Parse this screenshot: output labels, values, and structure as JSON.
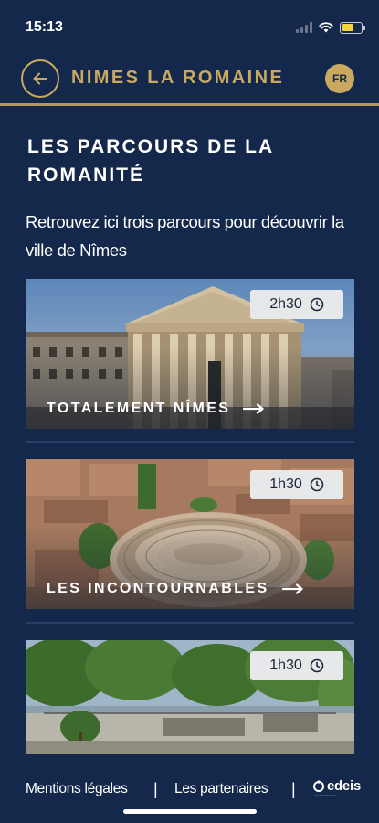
{
  "status_bar": {
    "time": "15:13",
    "battery_level": 0.6
  },
  "header": {
    "title": "NIMES LA ROMAINE",
    "language": "FR"
  },
  "page": {
    "title": "LES PARCOURS DE LA ROMANITÉ",
    "intro": "Retrouvez ici trois parcours pour découvrir la ville de Nîmes"
  },
  "routes": [
    {
      "label": "TOTALEMENT NÎMES",
      "duration": "2h30"
    },
    {
      "label": "LES INCONTOURNABLES",
      "duration": "1h30"
    },
    {
      "label": "",
      "duration": "1h30"
    }
  ],
  "footer": {
    "legal": "Mentions légales",
    "separator": "|",
    "partners": "Les partenaires",
    "brand": "edeis"
  },
  "colors": {
    "background": "#14284b",
    "accent_gold": "#c9a95f"
  }
}
